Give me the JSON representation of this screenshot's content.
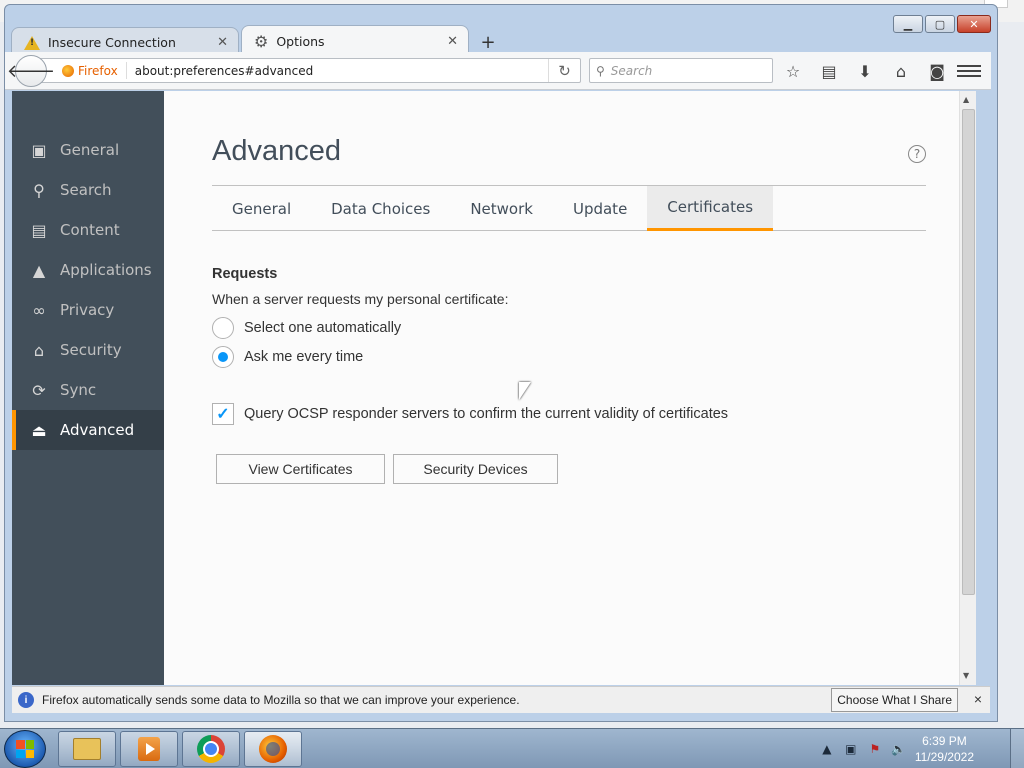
{
  "browser": {
    "tabs": [
      {
        "title": "Insecure Connection",
        "icon": "warning-icon",
        "active": false
      },
      {
        "title": "Options",
        "icon": "gear-icon",
        "active": true
      }
    ],
    "new_tab_label": "+",
    "identity_label": "Firefox",
    "url": "about:preferences#advanced",
    "search_placeholder": "Search"
  },
  "sidebar": {
    "items": [
      {
        "label": "General",
        "icon": "general-icon"
      },
      {
        "label": "Search",
        "icon": "search-icon"
      },
      {
        "label": "Content",
        "icon": "content-icon"
      },
      {
        "label": "Applications",
        "icon": "rocket-icon"
      },
      {
        "label": "Privacy",
        "icon": "mask-icon"
      },
      {
        "label": "Security",
        "icon": "lock-icon"
      },
      {
        "label": "Sync",
        "icon": "sync-icon"
      },
      {
        "label": "Advanced",
        "icon": "wizard-icon",
        "active": true
      }
    ]
  },
  "main": {
    "title": "Advanced",
    "help_label": "?",
    "tabs": [
      {
        "label": "General"
      },
      {
        "label": "Data Choices"
      },
      {
        "label": "Network"
      },
      {
        "label": "Update"
      },
      {
        "label": "Certificates",
        "active": true
      }
    ],
    "requests": {
      "heading": "Requests",
      "description": "When a server requests my personal certificate:",
      "options": [
        {
          "label": "Select one automatically",
          "checked": false
        },
        {
          "label": "Ask me every time",
          "checked": true
        }
      ]
    },
    "ocsp": {
      "label": "Query OCSP responder servers to confirm the current validity of certificates",
      "checked": true
    },
    "buttons": {
      "view_certificates": "View Certificates",
      "security_devices": "Security Devices"
    }
  },
  "notification": {
    "message": "Firefox automatically sends some data to Mozilla so that we can improve your experience.",
    "button": "Choose What I Share",
    "close": "×"
  },
  "taskbar": {
    "time": "6:39 PM",
    "date": "11/29/2022"
  },
  "colors": {
    "accent": "#ff9500",
    "sidebar_bg": "#424f5a",
    "check_blue": "#0996f8"
  }
}
